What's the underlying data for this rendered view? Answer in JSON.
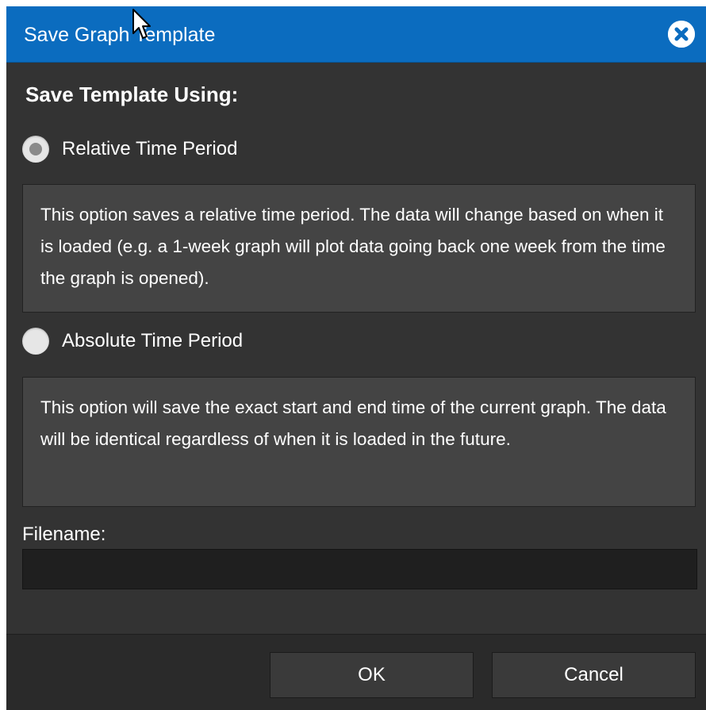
{
  "dialog": {
    "title": "Save Graph Template",
    "close_icon": "close-circle-x-icon"
  },
  "section_heading": "Save Template Using:",
  "options": [
    {
      "label": "Relative Time Period",
      "checked": true,
      "description": "This option saves a relative time period. The data will change based on when it is loaded (e.g. a 1-week graph will plot data going back one week from the time the graph is opened)."
    },
    {
      "label": "Absolute Time Period",
      "checked": false,
      "description": "This option will save the exact start and end time of the current graph. The data will be identical regardless of when it is loaded in the future."
    }
  ],
  "filename": {
    "label": "Filename:",
    "value": "",
    "placeholder": ""
  },
  "buttons": {
    "ok_label": "OK",
    "cancel_label": "Cancel"
  },
  "colors": {
    "titlebar": "#0b6cbf",
    "dialog_bg": "#333333",
    "desc_bg": "#444444",
    "input_bg": "#1f1f1f",
    "footer_bg": "#2a2a2a"
  }
}
